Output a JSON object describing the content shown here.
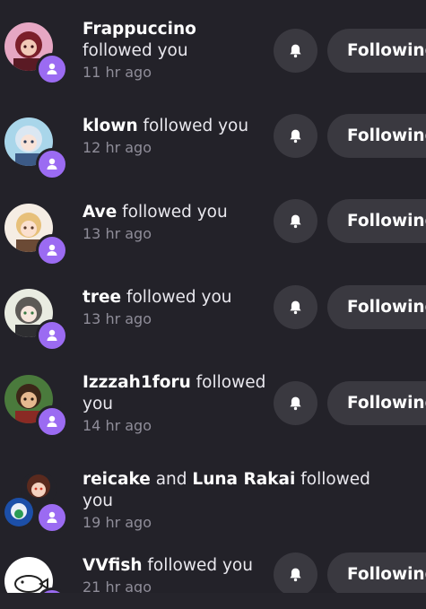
{
  "notifications": [
    {
      "name": "Frappuccino",
      "action": "followed you",
      "time": "11 hr ago",
      "button": "Following"
    },
    {
      "name": "klown",
      "action": "followed you",
      "time": "12 hr ago",
      "button": "Following"
    },
    {
      "name": "Ave",
      "action": "followed you",
      "time": "13 hr ago",
      "button": "Following"
    },
    {
      "name": "tree",
      "action": "followed you",
      "time": "13 hr ago",
      "button": "Following"
    },
    {
      "name": "Izzzah1foru",
      "action": "followed you",
      "time": "14 hr ago",
      "button": "Following"
    },
    {
      "name": "reicake",
      "conjunction": "and",
      "name2": "Luna Rakai",
      "action": "followed you",
      "time": "19 hr ago"
    },
    {
      "name": "VVfish",
      "action": "followed you",
      "time": "21 hr ago",
      "button": "Following"
    }
  ],
  "icons": {
    "badge": "person-icon",
    "bell": "bell-icon"
  },
  "colors": {
    "background": "#232229",
    "accent": "#9b6bf2",
    "button": "#3a3940",
    "muted": "#8f8d99"
  }
}
